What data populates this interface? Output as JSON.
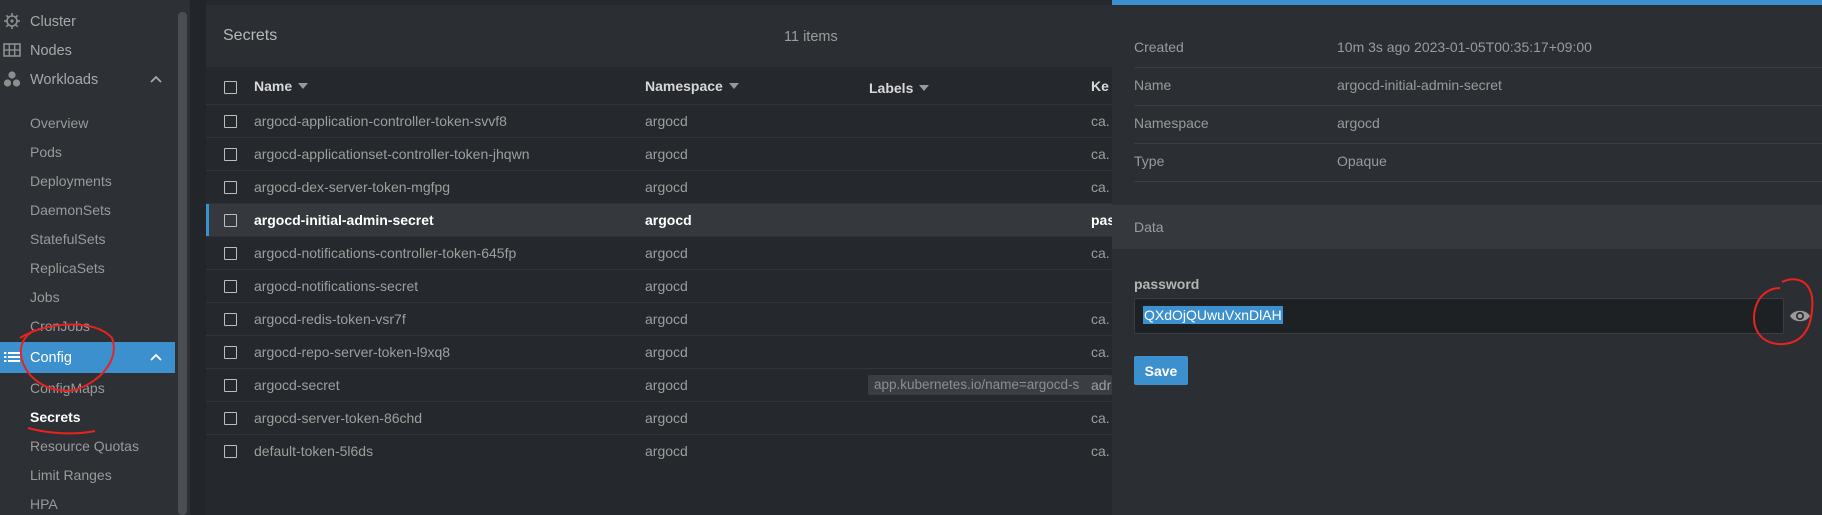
{
  "sidebar": {
    "top_items": [
      {
        "label": "Cluster",
        "icon": "helm-wheel-icon"
      },
      {
        "label": "Nodes",
        "icon": "nodes-icon"
      },
      {
        "label": "Workloads",
        "icon": "workloads-icon"
      }
    ],
    "workloads_children": [
      "Overview",
      "Pods",
      "Deployments",
      "DaemonSets",
      "StatefulSets",
      "ReplicaSets",
      "Jobs",
      "CronJobs"
    ],
    "config": {
      "label": "Config",
      "icon": "list-icon"
    },
    "config_children": [
      "ConfigMaps",
      "Secrets",
      "Resource Quotas",
      "Limit Ranges",
      "HPA"
    ],
    "active_child": "Secrets"
  },
  "list": {
    "title": "Secrets",
    "count": "11 items",
    "columns": {
      "name": "Name",
      "namespace": "Namespace",
      "labels": "Labels",
      "keys": "Ke"
    },
    "rows": [
      {
        "name": "argocd-application-controller-token-svvf8",
        "namespace": "argocd",
        "labels": "",
        "keys": "ca."
      },
      {
        "name": "argocd-applicationset-controller-token-jhqwn",
        "namespace": "argocd",
        "labels": "",
        "keys": "ca."
      },
      {
        "name": "argocd-dex-server-token-mgfpg",
        "namespace": "argocd",
        "labels": "",
        "keys": "ca."
      },
      {
        "name": "argocd-initial-admin-secret",
        "namespace": "argocd",
        "labels": "",
        "keys": "pas"
      },
      {
        "name": "argocd-notifications-controller-token-645fp",
        "namespace": "argocd",
        "labels": "",
        "keys": "ca."
      },
      {
        "name": "argocd-notifications-secret",
        "namespace": "argocd",
        "labels": "",
        "keys": ""
      },
      {
        "name": "argocd-redis-token-vsr7f",
        "namespace": "argocd",
        "labels": "",
        "keys": "ca."
      },
      {
        "name": "argocd-repo-server-token-l9xq8",
        "namespace": "argocd",
        "labels": "",
        "keys": "ca."
      },
      {
        "name": "argocd-secret",
        "namespace": "argocd",
        "labels": "app.kubernetes.io/name=argocd-s",
        "keys": "adr"
      },
      {
        "name": "argocd-server-token-86chd",
        "namespace": "argocd",
        "labels": "",
        "keys": "ca."
      },
      {
        "name": "default-token-5l6ds",
        "namespace": "argocd",
        "labels": "",
        "keys": "ca."
      }
    ]
  },
  "details": {
    "created_label": "Created",
    "created_value": "10m 3s ago 2023-01-05T00:35:17+09:00",
    "name_label": "Name",
    "name_value": "argocd-initial-admin-secret",
    "namespace_label": "Namespace",
    "namespace_value": "argocd",
    "type_label": "Type",
    "type_value": "Opaque",
    "data_title": "Data",
    "password_label": "password",
    "password_value": "QXdOjQUwuVxnDlAH",
    "save_label": "Save"
  },
  "colors": {
    "accent": "#3d90ce",
    "annotation": "#e8231f",
    "sidebar_bg": "#2d3035",
    "main_bg": "#25282c",
    "drawer_bg": "#2b2e33"
  }
}
